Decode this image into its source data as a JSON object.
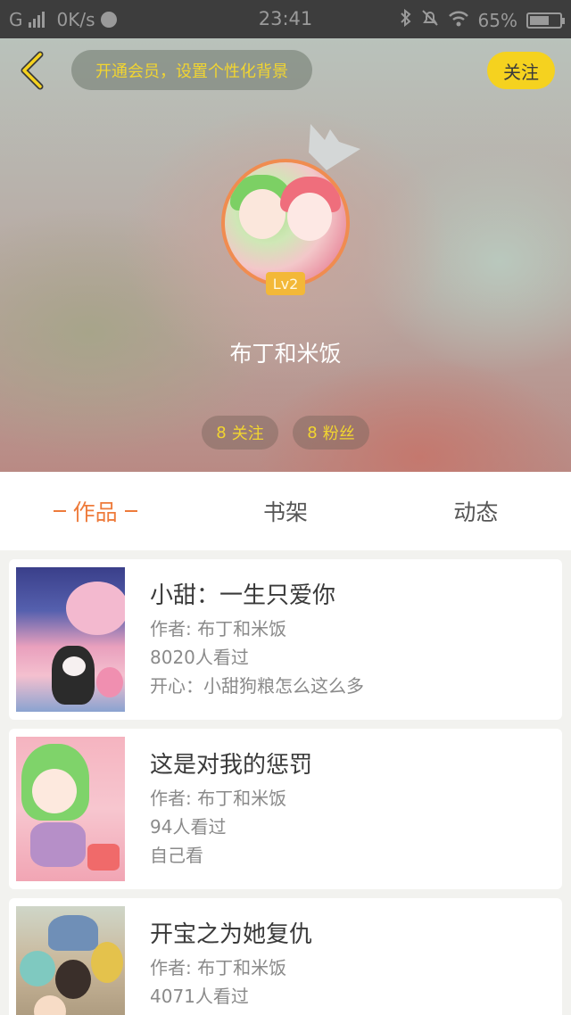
{
  "status_bar": {
    "network": "G",
    "speed": "0K/s",
    "time": "23:41",
    "battery": "65%",
    "battery_level": 0.65
  },
  "header": {
    "vip_text": "开通会员，设置个性化背景",
    "follow_label": "关注",
    "level": "Lv2",
    "username": "布丁和米饭",
    "following_count": "8",
    "following_label": "关注",
    "fans_count": "8",
    "fans_label": "粉丝"
  },
  "tabs": [
    {
      "label": "作品",
      "active": true
    },
    {
      "label": "书架",
      "active": false
    },
    {
      "label": "动态",
      "active": false
    }
  ],
  "works": [
    {
      "title": "小甜：一生只爱你",
      "author": "作者: 布丁和米饭",
      "views": "8020人看过",
      "desc": "开心：小甜狗粮怎么这么多"
    },
    {
      "title": "这是对我的惩罚",
      "author": "作者: 布丁和米饭",
      "views": "94人看过",
      "desc": "自己看"
    },
    {
      "title": "开宝之为她复仇",
      "author": "作者: 布丁和米饭",
      "views": "4071人看过",
      "desc": ""
    }
  ],
  "colors": {
    "accent": "#ee7b3b",
    "follow_button": "#f5d21f",
    "highlight_text": "#f2d530"
  }
}
